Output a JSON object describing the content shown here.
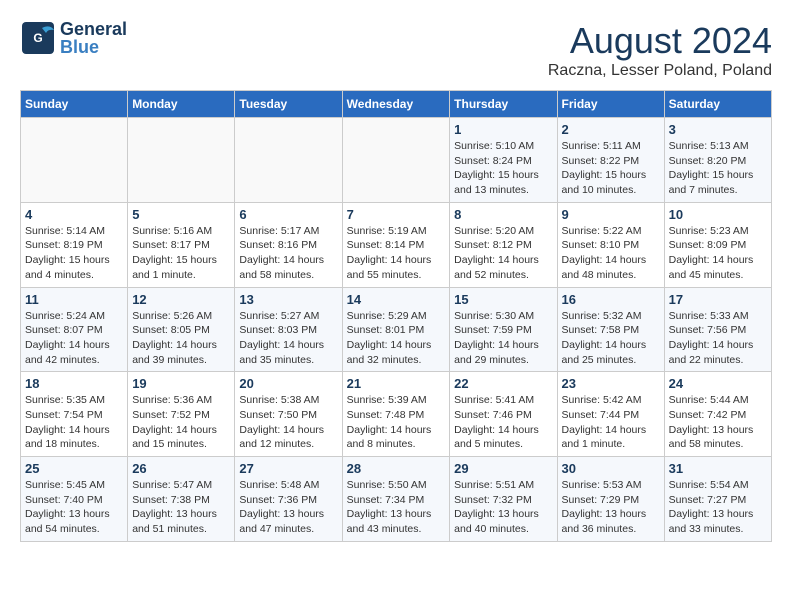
{
  "header": {
    "logo_general": "General",
    "logo_blue": "Blue",
    "month_title": "August 2024",
    "subtitle": "Raczna, Lesser Poland, Poland"
  },
  "calendar": {
    "headers": [
      "Sunday",
      "Monday",
      "Tuesday",
      "Wednesday",
      "Thursday",
      "Friday",
      "Saturday"
    ],
    "weeks": [
      [
        {
          "day": "",
          "info": ""
        },
        {
          "day": "",
          "info": ""
        },
        {
          "day": "",
          "info": ""
        },
        {
          "day": "",
          "info": ""
        },
        {
          "day": "1",
          "info": "Sunrise: 5:10 AM\nSunset: 8:24 PM\nDaylight: 15 hours\nand 13 minutes."
        },
        {
          "day": "2",
          "info": "Sunrise: 5:11 AM\nSunset: 8:22 PM\nDaylight: 15 hours\nand 10 minutes."
        },
        {
          "day": "3",
          "info": "Sunrise: 5:13 AM\nSunset: 8:20 PM\nDaylight: 15 hours\nand 7 minutes."
        }
      ],
      [
        {
          "day": "4",
          "info": "Sunrise: 5:14 AM\nSunset: 8:19 PM\nDaylight: 15 hours\nand 4 minutes."
        },
        {
          "day": "5",
          "info": "Sunrise: 5:16 AM\nSunset: 8:17 PM\nDaylight: 15 hours\nand 1 minute."
        },
        {
          "day": "6",
          "info": "Sunrise: 5:17 AM\nSunset: 8:16 PM\nDaylight: 14 hours\nand 58 minutes."
        },
        {
          "day": "7",
          "info": "Sunrise: 5:19 AM\nSunset: 8:14 PM\nDaylight: 14 hours\nand 55 minutes."
        },
        {
          "day": "8",
          "info": "Sunrise: 5:20 AM\nSunset: 8:12 PM\nDaylight: 14 hours\nand 52 minutes."
        },
        {
          "day": "9",
          "info": "Sunrise: 5:22 AM\nSunset: 8:10 PM\nDaylight: 14 hours\nand 48 minutes."
        },
        {
          "day": "10",
          "info": "Sunrise: 5:23 AM\nSunset: 8:09 PM\nDaylight: 14 hours\nand 45 minutes."
        }
      ],
      [
        {
          "day": "11",
          "info": "Sunrise: 5:24 AM\nSunset: 8:07 PM\nDaylight: 14 hours\nand 42 minutes."
        },
        {
          "day": "12",
          "info": "Sunrise: 5:26 AM\nSunset: 8:05 PM\nDaylight: 14 hours\nand 39 minutes."
        },
        {
          "day": "13",
          "info": "Sunrise: 5:27 AM\nSunset: 8:03 PM\nDaylight: 14 hours\nand 35 minutes."
        },
        {
          "day": "14",
          "info": "Sunrise: 5:29 AM\nSunset: 8:01 PM\nDaylight: 14 hours\nand 32 minutes."
        },
        {
          "day": "15",
          "info": "Sunrise: 5:30 AM\nSunset: 7:59 PM\nDaylight: 14 hours\nand 29 minutes."
        },
        {
          "day": "16",
          "info": "Sunrise: 5:32 AM\nSunset: 7:58 PM\nDaylight: 14 hours\nand 25 minutes."
        },
        {
          "day": "17",
          "info": "Sunrise: 5:33 AM\nSunset: 7:56 PM\nDaylight: 14 hours\nand 22 minutes."
        }
      ],
      [
        {
          "day": "18",
          "info": "Sunrise: 5:35 AM\nSunset: 7:54 PM\nDaylight: 14 hours\nand 18 minutes."
        },
        {
          "day": "19",
          "info": "Sunrise: 5:36 AM\nSunset: 7:52 PM\nDaylight: 14 hours\nand 15 minutes."
        },
        {
          "day": "20",
          "info": "Sunrise: 5:38 AM\nSunset: 7:50 PM\nDaylight: 14 hours\nand 12 minutes."
        },
        {
          "day": "21",
          "info": "Sunrise: 5:39 AM\nSunset: 7:48 PM\nDaylight: 14 hours\nand 8 minutes."
        },
        {
          "day": "22",
          "info": "Sunrise: 5:41 AM\nSunset: 7:46 PM\nDaylight: 14 hours\nand 5 minutes."
        },
        {
          "day": "23",
          "info": "Sunrise: 5:42 AM\nSunset: 7:44 PM\nDaylight: 14 hours\nand 1 minute."
        },
        {
          "day": "24",
          "info": "Sunrise: 5:44 AM\nSunset: 7:42 PM\nDaylight: 13 hours\nand 58 minutes."
        }
      ],
      [
        {
          "day": "25",
          "info": "Sunrise: 5:45 AM\nSunset: 7:40 PM\nDaylight: 13 hours\nand 54 minutes."
        },
        {
          "day": "26",
          "info": "Sunrise: 5:47 AM\nSunset: 7:38 PM\nDaylight: 13 hours\nand 51 minutes."
        },
        {
          "day": "27",
          "info": "Sunrise: 5:48 AM\nSunset: 7:36 PM\nDaylight: 13 hours\nand 47 minutes."
        },
        {
          "day": "28",
          "info": "Sunrise: 5:50 AM\nSunset: 7:34 PM\nDaylight: 13 hours\nand 43 minutes."
        },
        {
          "day": "29",
          "info": "Sunrise: 5:51 AM\nSunset: 7:32 PM\nDaylight: 13 hours\nand 40 minutes."
        },
        {
          "day": "30",
          "info": "Sunrise: 5:53 AM\nSunset: 7:29 PM\nDaylight: 13 hours\nand 36 minutes."
        },
        {
          "day": "31",
          "info": "Sunrise: 5:54 AM\nSunset: 7:27 PM\nDaylight: 13 hours\nand 33 minutes."
        }
      ]
    ]
  }
}
